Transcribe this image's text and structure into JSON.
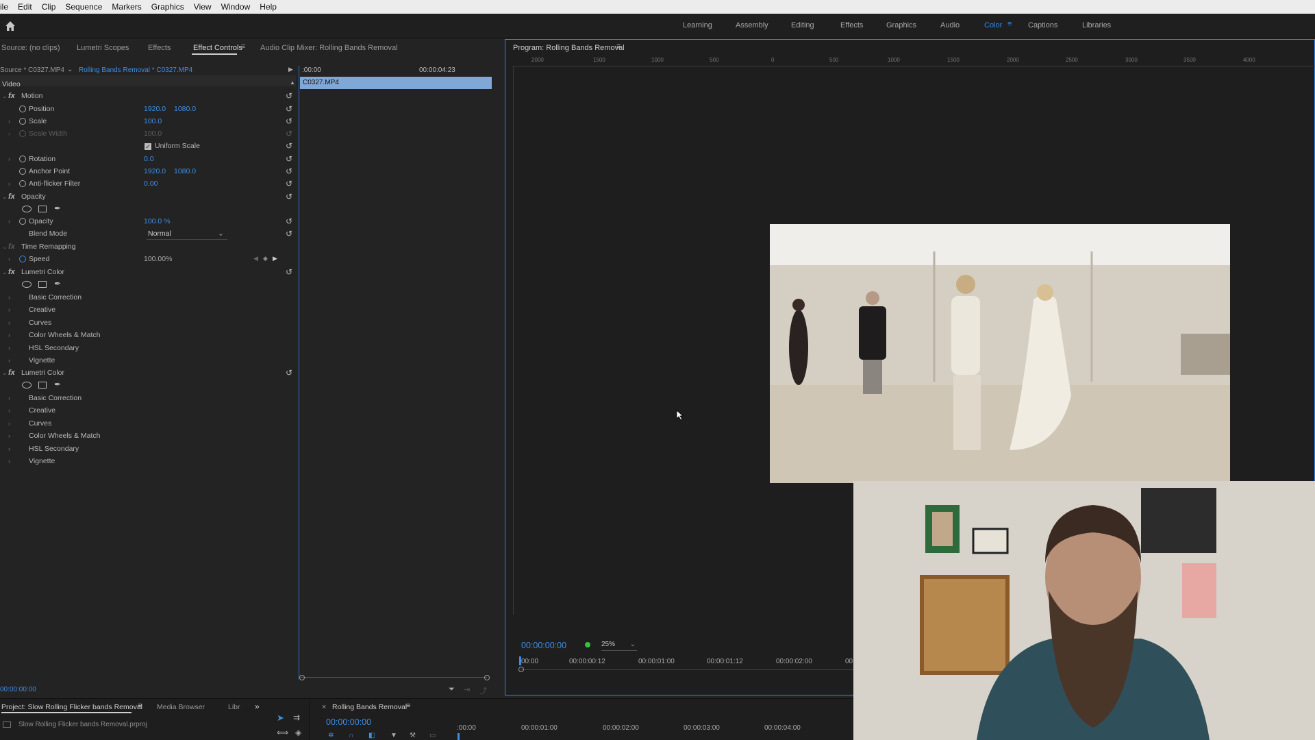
{
  "menu": [
    "ile",
    "Edit",
    "Clip",
    "Sequence",
    "Markers",
    "Graphics",
    "View",
    "Window",
    "Help"
  ],
  "workspaces": [
    {
      "label": "Learning",
      "active": false
    },
    {
      "label": "Assembly",
      "active": false
    },
    {
      "label": "Editing",
      "active": false
    },
    {
      "label": "Effects",
      "active": false
    },
    {
      "label": "Graphics",
      "active": false
    },
    {
      "label": "Audio",
      "active": false
    },
    {
      "label": "Color",
      "active": true
    },
    {
      "label": "Captions",
      "active": false
    },
    {
      "label": "Libraries",
      "active": false
    }
  ],
  "left_tabs": {
    "source": "Source: (no clips)",
    "lumetri_scopes": "Lumetri Scopes",
    "effects": "Effects",
    "effect_controls": "Effect Controls",
    "audio_mixer": "Audio Clip Mixer: Rolling Bands Removal"
  },
  "ec_header": {
    "source": "Source * C0327.MP4",
    "sequence": "Rolling Bands Removal * C0327.MP4",
    "time_start": ":00:00",
    "time_end": "00:00:04:23",
    "clip_name": "C0327.MP4"
  },
  "effects": {
    "video": "Video",
    "motion": "Motion",
    "position": {
      "label": "Position",
      "x": "1920.0",
      "y": "1080.0"
    },
    "scale": {
      "label": "Scale",
      "value": "100.0"
    },
    "scale_width": {
      "label": "Scale Width",
      "value": "100.0"
    },
    "uniform_scale": "Uniform Scale",
    "rotation": {
      "label": "Rotation",
      "value": "0.0"
    },
    "anchor": {
      "label": "Anchor Point",
      "x": "1920.0",
      "y": "1080.0"
    },
    "antiflicker": {
      "label": "Anti-flicker Filter",
      "value": "0.00"
    },
    "opacity_group": "Opacity",
    "opacity": {
      "label": "Opacity",
      "value": "100.0 %"
    },
    "blend": {
      "label": "Blend Mode",
      "value": "Normal"
    },
    "time_remap": "Time Remapping",
    "speed": {
      "label": "Speed",
      "value": "100.00%"
    },
    "lumetri1": "Lumetri Color",
    "lumetri2": "Lumetri Color",
    "sub": [
      "Basic Correction",
      "Creative",
      "Curves",
      "Color Wheels & Match",
      "HSL Secondary",
      "Vignette"
    ]
  },
  "ec_footer_time": "00:00:00:00",
  "program": {
    "title": "Program: Rolling Bands Removal",
    "ruler": [
      "2000",
      "1500",
      "1000",
      "500",
      "0",
      "500",
      "1000",
      "1500",
      "2000",
      "2500",
      "3000",
      "3500",
      "4000"
    ],
    "timecode": "00:00:00:00",
    "zoom": "25%",
    "timeline_ticks": [
      "00:00",
      "00:00:00:12",
      "00:00:01:00",
      "00:00:01:12",
      "00:00:02:00",
      "00"
    ]
  },
  "project": {
    "tab": "Project: Slow Rolling Flicker bands Removal",
    "media_browser": "Media Browser",
    "libraries": "Libr",
    "file": "Slow Rolling Flicker bands Removal.prproj"
  },
  "timeline": {
    "tab": "Rolling Bands Removal",
    "timecode": "00:00:00:00",
    "ticks": [
      ":00:00",
      "00:00:01:00",
      "00:00:02:00",
      "00:00:03:00",
      "00:00:04:00"
    ]
  },
  "colors": {
    "accent": "#2d8ceb",
    "panel": "#232323",
    "clip": "#7fa8d6"
  }
}
